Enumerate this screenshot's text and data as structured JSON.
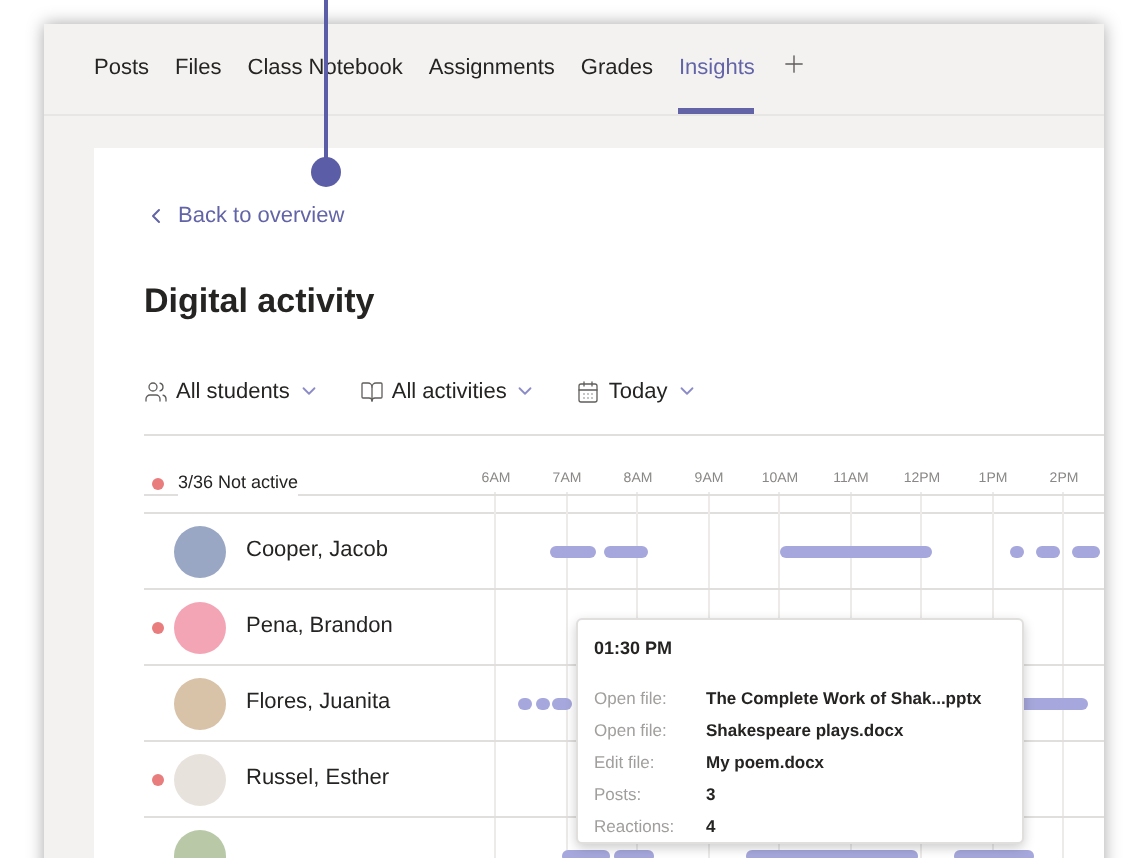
{
  "tabs": [
    {
      "label": "Posts",
      "selected": false
    },
    {
      "label": "Files",
      "selected": false
    },
    {
      "label": "Class Notebook",
      "selected": false
    },
    {
      "label": "Assignments",
      "selected": false
    },
    {
      "label": "Grades",
      "selected": false
    },
    {
      "label": "Insights",
      "selected": true
    }
  ],
  "back_link": "Back to overview",
  "title": "Digital activity",
  "filters": [
    {
      "kind": "students",
      "label": "All students"
    },
    {
      "kind": "activities",
      "label": "All activities"
    },
    {
      "kind": "date",
      "label": "Today"
    }
  ],
  "summary": "3/36 Not active",
  "hours": [
    "6AM",
    "7AM",
    "8AM",
    "9AM",
    "10AM",
    "11AM",
    "12PM",
    "1PM",
    "2PM"
  ],
  "students": [
    {
      "name": "Cooper, Jacob",
      "inactive": false
    },
    {
      "name": "Pena, Brandon",
      "inactive": true
    },
    {
      "name": "Flores, Juanita",
      "inactive": false
    },
    {
      "name": "Russel, Esther",
      "inactive": true
    }
  ],
  "tooltip": {
    "time": "01:30 PM",
    "rows": [
      {
        "label": "Open file:",
        "value": "The Complete Work of Shak...pptx"
      },
      {
        "label": "Open file:",
        "value": "Shakespeare plays.docx"
      },
      {
        "label": "Edit file:",
        "value": "My poem.docx"
      },
      {
        "label": "Posts:",
        "value": "3"
      },
      {
        "label": "Reactions:",
        "value": "4"
      }
    ]
  }
}
